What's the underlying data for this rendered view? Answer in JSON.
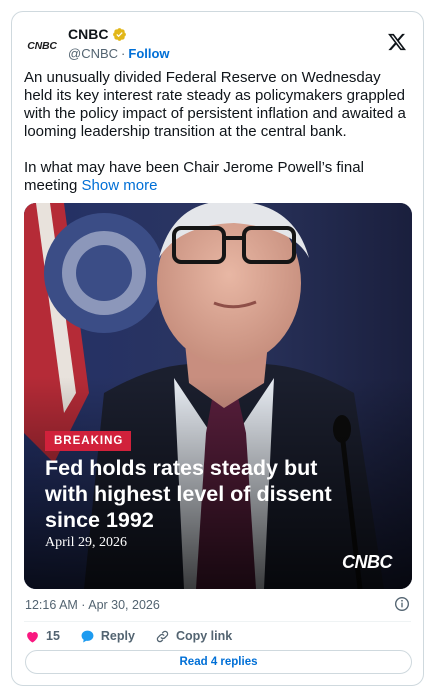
{
  "author": {
    "avatar_text": "CNBC",
    "display_name": "CNBC",
    "handle": "@CNBC",
    "separator": "·",
    "follow_label": "Follow"
  },
  "tweet": {
    "paragraph1": "An unusually divided Federal Reserve on Wednesday held its key interest rate steady as policymakers grappled with the policy impact of persistent inflation and awaited a looming leadership transition at the central bank.",
    "paragraph2": "In what may have been Chair Jerome Powell’s final meeting",
    "show_more": "Show more"
  },
  "media": {
    "badge": "BREAKING",
    "headline": "Fed holds rates steady but with highest level of dissent since 1992",
    "date": "April 29, 2026",
    "brand": "CNBC"
  },
  "footer": {
    "timestamp": "12:16 AM · Apr 30, 2026",
    "like_count": "15",
    "reply_label": "Reply",
    "copy_link_label": "Copy link",
    "read_replies_label": "Read 4 replies"
  },
  "colors": {
    "link": "#006fd6",
    "like": "#f91880",
    "reply": "#1d9bf0",
    "breaking": "#d1213b",
    "verified": "#e2b719"
  }
}
